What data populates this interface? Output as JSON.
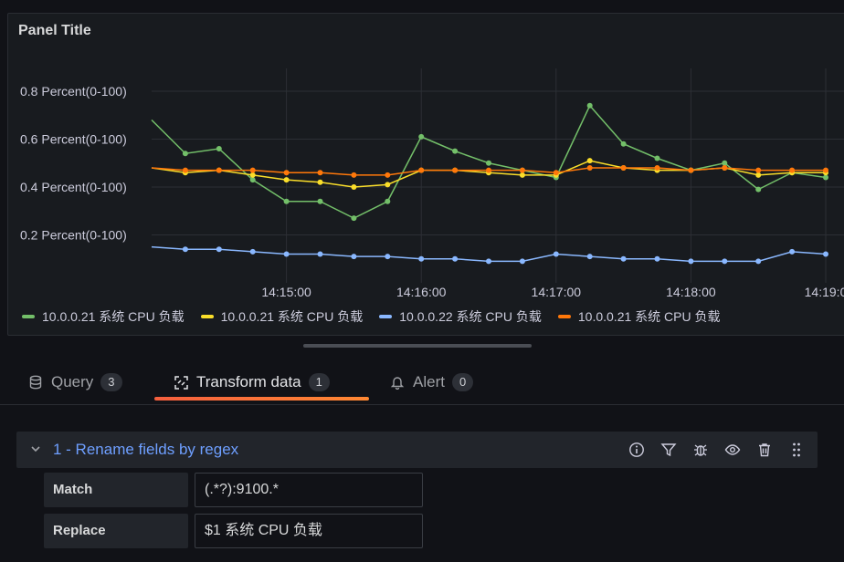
{
  "panel": {
    "title": "Panel Title"
  },
  "chart_data": {
    "type": "line",
    "x": [
      "14:14:00",
      "14:14:15",
      "14:14:30",
      "14:14:45",
      "14:15:00",
      "14:15:15",
      "14:15:30",
      "14:15:45",
      "14:16:00",
      "14:16:15",
      "14:16:30",
      "14:16:45",
      "14:17:00",
      "14:17:15",
      "14:17:30",
      "14:17:45",
      "14:18:00",
      "14:18:15",
      "14:18:30",
      "14:18:45",
      "14:19:00"
    ],
    "x_tick_labels": [
      "14:15:00",
      "14:16:00",
      "14:17:00",
      "14:18:00",
      "14:19:0"
    ],
    "y_tick_labels": [
      "0.8 Percent(0-100)",
      "0.6 Percent(0-100)",
      "0.4 Percent(0-100)",
      "0.2 Percent(0-100)"
    ],
    "y_ticks": [
      0.8,
      0.6,
      0.4,
      0.2
    ],
    "ylim": [
      0,
      0.88
    ],
    "grid": true,
    "legend_position": "bottom",
    "series": [
      {
        "name": "10.0.0.21 系统 CPU 负载",
        "color": "#73bf69",
        "values": [
          0.68,
          0.54,
          0.56,
          0.43,
          0.34,
          0.34,
          0.27,
          0.34,
          0.61,
          0.55,
          0.5,
          0.47,
          0.44,
          0.74,
          0.58,
          0.52,
          0.47,
          0.5,
          0.39,
          0.46,
          0.44
        ]
      },
      {
        "name": "10.0.0.21 系统 CPU 负载",
        "color": "#fade2a",
        "values": [
          0.48,
          0.46,
          0.47,
          0.45,
          0.43,
          0.42,
          0.4,
          0.41,
          0.47,
          0.47,
          0.46,
          0.45,
          0.45,
          0.51,
          0.48,
          0.47,
          0.47,
          0.48,
          0.45,
          0.46,
          0.46
        ]
      },
      {
        "name": "10.0.0.22 系统 CPU 负载",
        "color": "#8ab8ff",
        "values": [
          0.15,
          0.14,
          0.14,
          0.13,
          0.12,
          0.12,
          0.11,
          0.11,
          0.1,
          0.1,
          0.09,
          0.09,
          0.12,
          0.11,
          0.1,
          0.1,
          0.09,
          0.09,
          0.09,
          0.13,
          0.12
        ]
      },
      {
        "name": "10.0.0.21 系统 CPU 负载",
        "color": "#ff780a",
        "values": [
          0.48,
          0.47,
          0.47,
          0.47,
          0.46,
          0.46,
          0.45,
          0.45,
          0.47,
          0.47,
          0.47,
          0.47,
          0.46,
          0.48,
          0.48,
          0.48,
          0.47,
          0.48,
          0.47,
          0.47,
          0.47
        ]
      }
    ]
  },
  "tabs": [
    {
      "label": "Query",
      "count": "3",
      "icon": "database-icon"
    },
    {
      "label": "Transform data",
      "count": "1",
      "icon": "transform-icon"
    },
    {
      "label": "Alert",
      "count": "0",
      "icon": "bell-icon"
    }
  ],
  "transformation": {
    "title": "1 - Rename fields by regex",
    "match_label": "Match",
    "match_value": "(.*?):9100.*",
    "replace_label": "Replace",
    "replace_value": "$1 系统 CPU 负载",
    "action_icons": [
      "info-icon",
      "filter-icon",
      "bug-icon",
      "eye-icon",
      "trash-icon",
      "drag-handle-icon"
    ]
  },
  "colors": {
    "accent": "#6e9fff",
    "tab_underline": "#ff8833"
  }
}
